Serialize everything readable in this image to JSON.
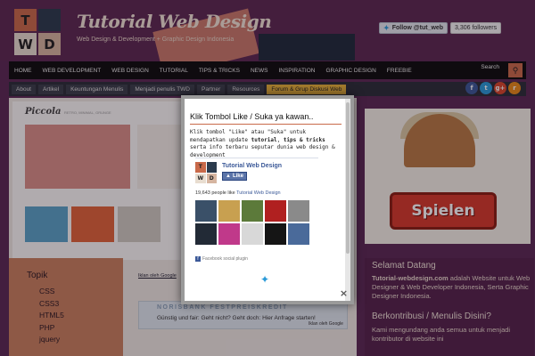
{
  "header": {
    "logo_letters": [
      "T",
      "",
      "W",
      "D"
    ],
    "site_title": "Tutorial Web Design",
    "tagline": "Web Design & Development + Graphic Design Indonesia",
    "follow_label": "Follow @tut_web",
    "followers": "3,306 followers"
  },
  "nav": {
    "items": [
      "HOME",
      "WEB DEVELOPMENT",
      "WEB DESIGN",
      "TUTORIAL",
      "TIPS & TRICKS",
      "NEWS",
      "INSPIRATION",
      "GRAPHIC DESIGN",
      "FREEBIE"
    ],
    "search_label": "Search",
    "search_icon": "search-icon"
  },
  "subnav": {
    "items": [
      "About",
      "Artikel",
      "Keuntungan Menulis",
      "Menjadi penulis TWD",
      "Partner",
      "Resources",
      "Forum & Grup Diskusi Web"
    ],
    "highlight_index": 6
  },
  "social": {
    "icons": [
      "facebook-icon",
      "twitter-icon",
      "google-plus-icon",
      "rss-icon"
    ],
    "glyphs": [
      "f",
      "t",
      "g+",
      "r"
    ]
  },
  "content": {
    "shot_logo": "Piccola",
    "shot_nav": "RETRO, MINIMAL, GRUNGE",
    "iklan_label": "Iklan oleh Google",
    "ad_title": "NORISBANK FESTPREISKREDIT",
    "ad_text": "Günstig und fair: Geht nicht? Geht doch: Hier Anfrage starten!",
    "ad_iklan": "Iklan oleh Google"
  },
  "sidebar_left": {
    "title": "Topik",
    "items": [
      "CSS",
      "CSS3",
      "HTML5",
      "PHP",
      "jquery"
    ]
  },
  "sidebar_right": {
    "game_button": "Spielen",
    "welcome_title": "Selamat Datang",
    "welcome_site": "Tutorial-webdesign.com",
    "welcome_text": "adalah Website untuk Web Designer & Web Developer Indonesia, Serta Graphic Designer Indonesia.",
    "contribute_title": "Berkontribusi / Menulis Disini?",
    "contribute_text": "Kami mengundang anda semua untuk menjadi kontributor di website ini"
  },
  "modal": {
    "title": "Klik Tombol Like / Suka ya kawan..",
    "description_prefix": "Klik tombol \"Like\" atau \"Suka\" untuk mendapatkan update",
    "description_link1": "tutorial",
    "description_mid": ",",
    "description_link2": "tips & tricks",
    "description_suffix": "serta info terbaru seputar dunia web design & development",
    "fb_name": "Tutorial Web Design",
    "fb_like": "Like",
    "fb_count_prefix": "19,643 people like",
    "fb_count_name": "Tutorial Web Design",
    "fb_plugin": "Facebook social plugin",
    "close_label": "×"
  },
  "colors": {
    "accent": "#c96a4a",
    "nav_bg": "#0e0e0e",
    "highlight": "#e6b23a",
    "facebook": "#3b5998",
    "twitter": "#2a9ad8"
  }
}
